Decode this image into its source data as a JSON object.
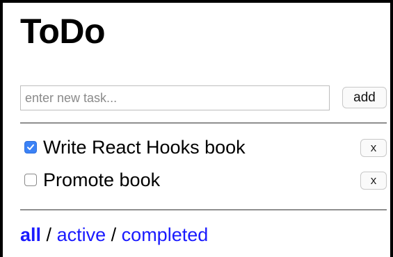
{
  "app": {
    "title": "ToDo"
  },
  "new_task": {
    "placeholder": "enter new task...",
    "add_label": "add"
  },
  "tasks": [
    {
      "label": "Write React Hooks book",
      "completed": true,
      "remove_label": "x"
    },
    {
      "label": "Promote book",
      "completed": false,
      "remove_label": "x"
    }
  ],
  "filters": {
    "all": "all",
    "active": "active",
    "completed": "completed",
    "separator": "/",
    "selected": "all"
  },
  "colors": {
    "link": "#1a1aff",
    "checkbox_checked": "#3b82f6"
  }
}
